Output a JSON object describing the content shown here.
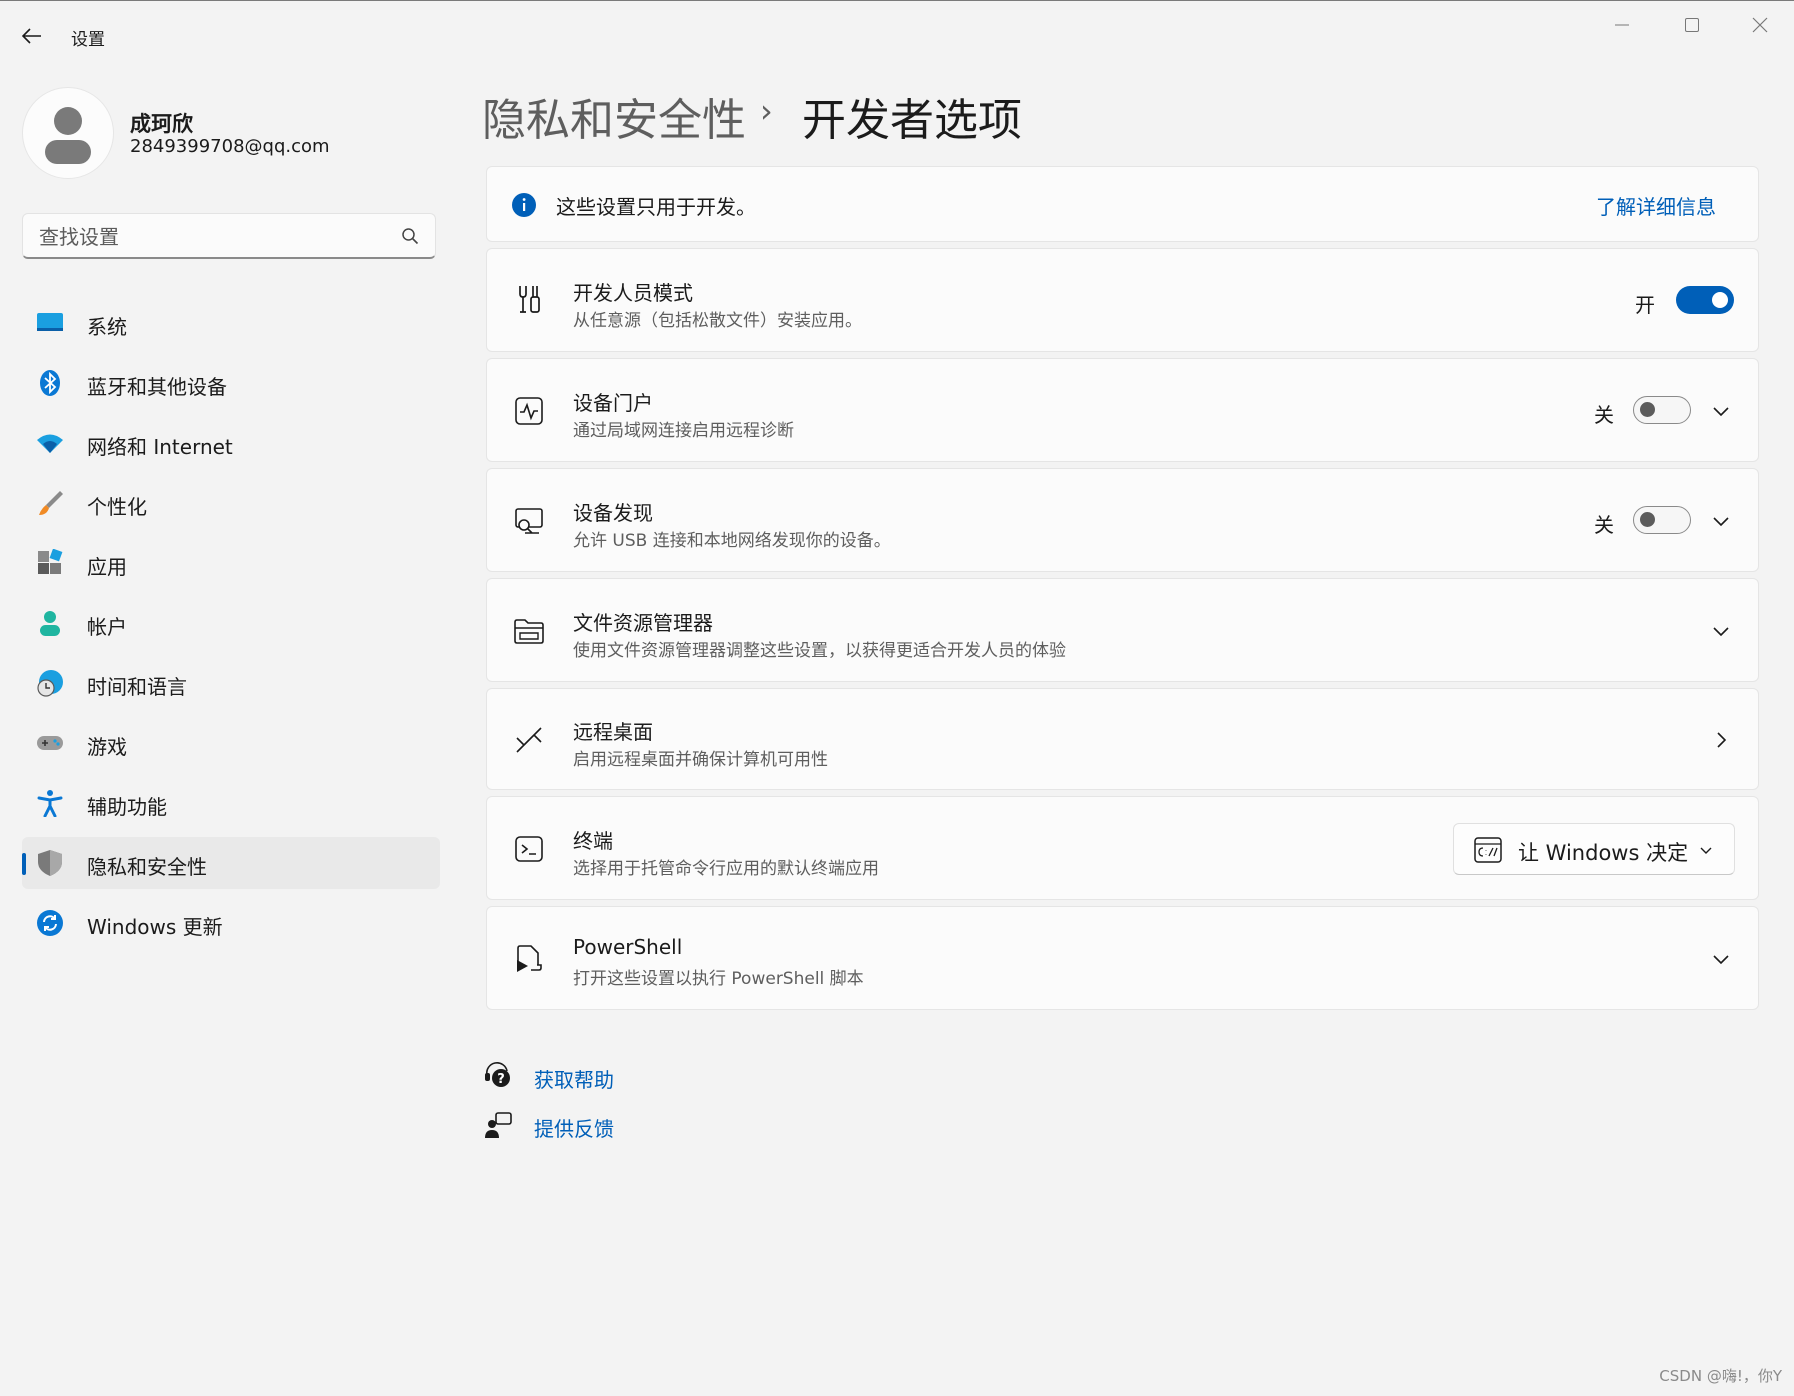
{
  "window": {
    "title": "设置",
    "back_icon": "arrow-left-icon",
    "controls": [
      "minimize-icon",
      "maximize-icon",
      "close-icon"
    ]
  },
  "user": {
    "name": "成珂欣",
    "email": "2849399708@qq.com"
  },
  "search": {
    "placeholder": "查找设置"
  },
  "nav": {
    "items": [
      {
        "label": "系统",
        "icon": "display-icon"
      },
      {
        "label": "蓝牙和其他设备",
        "icon": "bluetooth-icon"
      },
      {
        "label": "网络和 Internet",
        "icon": "wifi-icon"
      },
      {
        "label": "个性化",
        "icon": "paintbrush-icon"
      },
      {
        "label": "应用",
        "icon": "apps-icon"
      },
      {
        "label": "帐户",
        "icon": "person-icon"
      },
      {
        "label": "时间和语言",
        "icon": "globe-clock-icon"
      },
      {
        "label": "游戏",
        "icon": "gamepad-icon"
      },
      {
        "label": "辅助功能",
        "icon": "accessibility-icon"
      },
      {
        "label": "隐私和安全性",
        "icon": "shield-icon",
        "selected": true
      },
      {
        "label": "Windows 更新",
        "icon": "refresh-icon"
      }
    ]
  },
  "breadcrumb": {
    "parent": "隐私和安全性",
    "separator": "›",
    "current": "开发者选项"
  },
  "info": {
    "text": "这些设置只用于开发。",
    "link": "了解详细信息"
  },
  "cards": {
    "dev_mode": {
      "title": "开发人员模式",
      "subtitle": "从任意源（包括松散文件）安装应用。",
      "state": "开"
    },
    "device_portal": {
      "title": "设备门户",
      "subtitle": "通过局域网连接启用远程诊断",
      "state": "关"
    },
    "device_discovery": {
      "title": "设备发现",
      "subtitle": "允许 USB 连接和本地网络发现你的设备。",
      "state": "关"
    },
    "file_explorer": {
      "title": "文件资源管理器",
      "subtitle": "使用文件资源管理器调整这些设置，以获得更适合开发人员的体验"
    },
    "remote_desktop": {
      "title": "远程桌面",
      "subtitle": "启用远程桌面并确保计算机可用性"
    },
    "terminal": {
      "title": "终端",
      "subtitle": "选择用于托管命令行应用的默认终端应用",
      "dropdown_value": "让 Windows 决定"
    },
    "powershell": {
      "title": "PowerShell",
      "subtitle": "打开这些设置以执行 PowerShell 脚本"
    }
  },
  "footer": {
    "help": "获取帮助",
    "feedback": "提供反馈"
  },
  "watermark": "CSDN @嗨!，你Y",
  "colors": {
    "accent": "#005fb8",
    "background": "#f3f3f3",
    "card": "#fbfbfb"
  }
}
